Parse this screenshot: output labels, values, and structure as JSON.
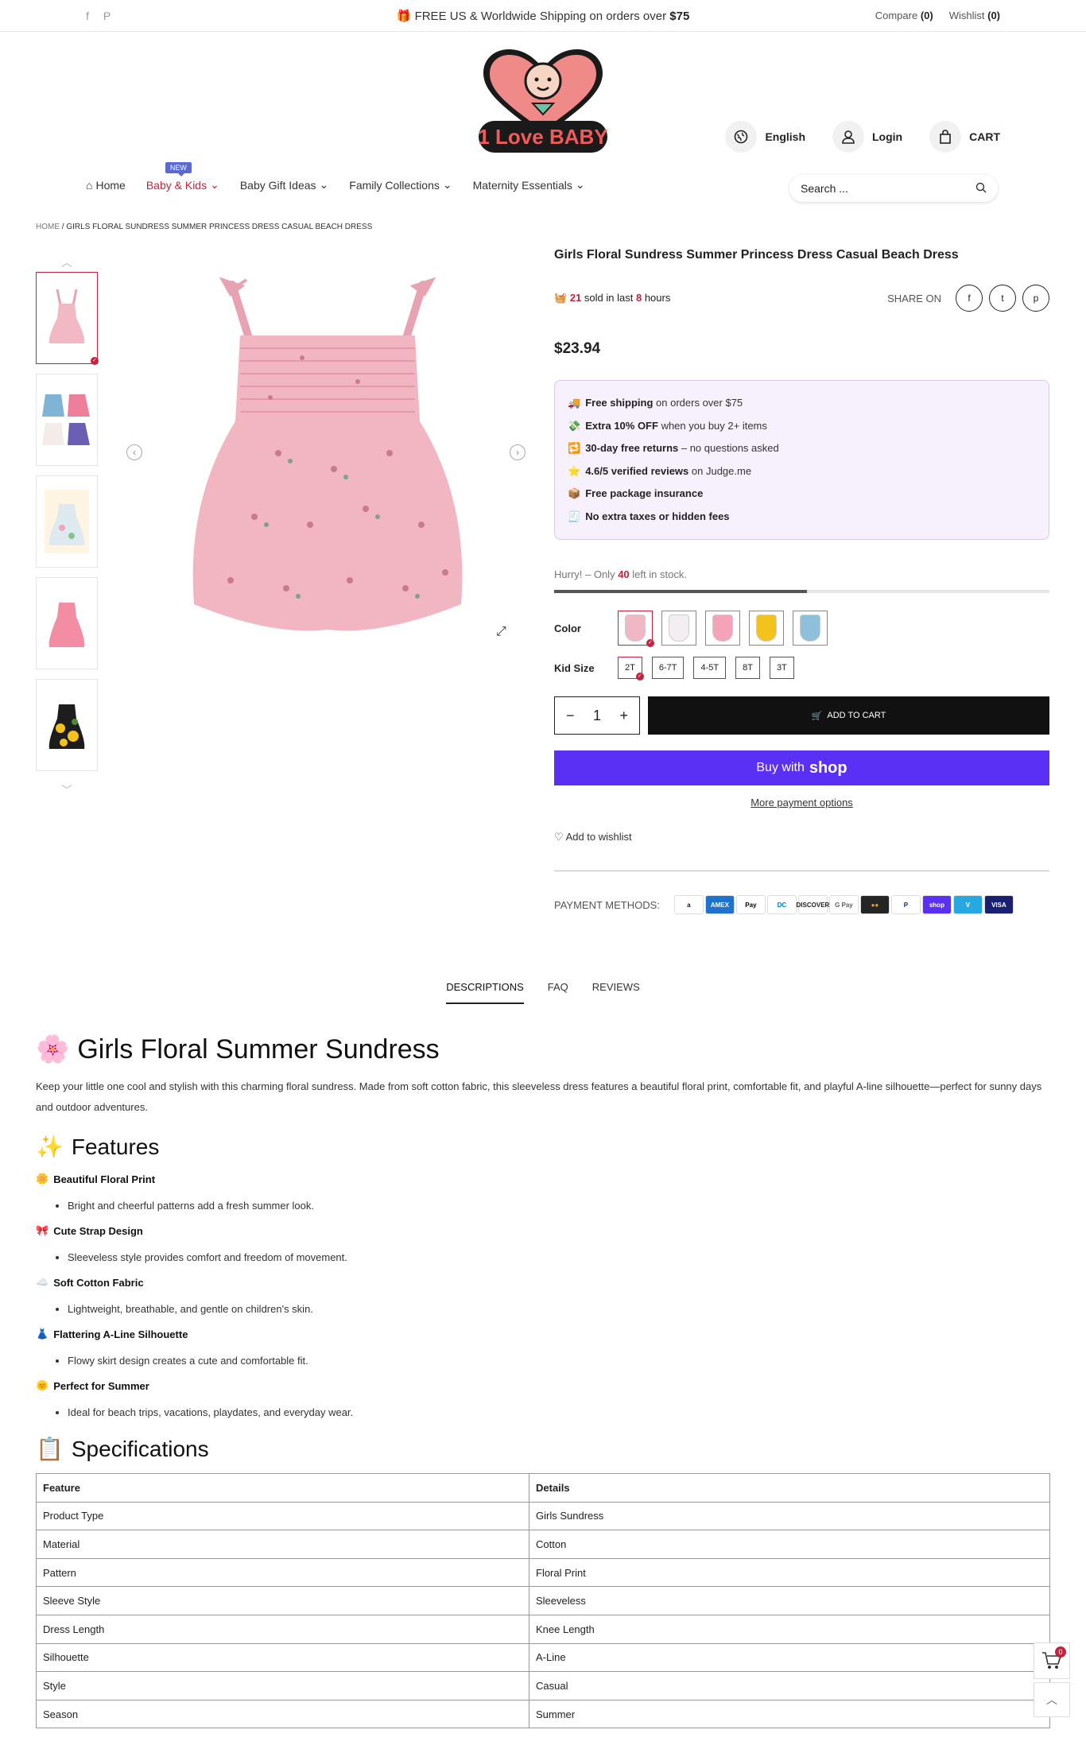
{
  "topbar": {
    "social": [
      "f",
      "P"
    ],
    "promo_prefix": "FREE US & Worldwide Shipping on orders over",
    "promo_amount": "$75",
    "compare_label": "Compare",
    "compare_count": "(0)",
    "wishlist_label": "Wishlist",
    "wishlist_count": "(0)"
  },
  "brand": {
    "logo_text": "1 Love BABY"
  },
  "header": {
    "language": "English",
    "login": "Login",
    "cart": "CART"
  },
  "nav": {
    "home": "Home",
    "new_badge": "NEW",
    "items": [
      "Baby & Kids",
      "Baby Gift Ideas",
      "Family Collections",
      "Maternity Essentials"
    ]
  },
  "search": {
    "placeholder": "Search ..."
  },
  "breadcrumb": {
    "home": "HOME",
    "sep": "/",
    "current": "GIRLS FLORAL SUNDRESS SUMMER PRINCESS DRESS CASUAL BEACH DRESS"
  },
  "product": {
    "title": "Girls Floral Sundress Summer Princess Dress Casual Beach Dress",
    "sold_count": "21",
    "sold_text_1": "sold in last",
    "sold_hours": "8",
    "sold_text_2": "hours",
    "share_label": "SHARE ON",
    "share_icons": [
      "f",
      "t",
      "p"
    ],
    "price": "$23.94",
    "perks": [
      {
        "icon": "🚚",
        "bold": "Free shipping",
        "rest": " on orders over $75"
      },
      {
        "icon": "💸",
        "bold": "Extra 10% OFF",
        "rest": " when you buy 2+ items"
      },
      {
        "icon": "🔁",
        "bold": "30-day free returns",
        "rest": " – no questions asked"
      },
      {
        "icon": "⭐",
        "bold": "4.6/5 verified reviews",
        "rest": " on Judge.me"
      },
      {
        "icon": "📦",
        "bold": "Free package insurance",
        "rest": ""
      },
      {
        "icon": "🧾",
        "bold": "No extra taxes or hidden fees",
        "rest": ""
      }
    ],
    "stock_prefix": "Hurry! – Only",
    "stock_count": "40",
    "stock_suffix": "left in stock.",
    "stock_fraction": 0.51,
    "color_label": "Color",
    "colors": [
      "#f0b7c4",
      "#f3eef2",
      "#f4a3b8",
      "#f2c31c",
      "#8ebfdb"
    ],
    "size_label": "Kid Size",
    "sizes": [
      "2T",
      "6-7T",
      "4-5T",
      "8T",
      "3T"
    ],
    "qty_minus": "−",
    "qty_value": "1",
    "qty_plus": "+",
    "add_to_cart": "ADD TO CART",
    "buy_with": "Buy with",
    "shop_word": "shop",
    "more_payment": "More payment options",
    "wishlist": "Add to wishlist",
    "payment_label": "PAYMENT METHODS:",
    "payment_cards": [
      {
        "label": "a",
        "bg": "#ffffff",
        "fg": "#111111"
      },
      {
        "label": "AMEX",
        "bg": "#1f72cd",
        "fg": "#ffffff"
      },
      {
        "label": " Pay",
        "bg": "#ffffff",
        "fg": "#000000"
      },
      {
        "label": "DC",
        "bg": "#ffffff",
        "fg": "#0079be"
      },
      {
        "label": "DISCOVER",
        "bg": "#ffffff",
        "fg": "#222222"
      },
      {
        "label": "G Pay",
        "bg": "#ffffff",
        "fg": "#5f6368"
      },
      {
        "label": "●●",
        "bg": "#252525",
        "fg": "#f79e1b"
      },
      {
        "label": "P",
        "bg": "#ffffff",
        "fg": "#003087"
      },
      {
        "label": "shop",
        "bg": "#5a31f4",
        "fg": "#ffffff"
      },
      {
        "label": "V",
        "bg": "#28a8e0",
        "fg": "#ffffff"
      },
      {
        "label": "VISA",
        "bg": "#1a1f71",
        "fg": "#ffffff"
      }
    ]
  },
  "tabs": [
    "DESCRIPTIONS",
    "FAQ",
    "REVIEWS"
  ],
  "description": {
    "title_icon": "🌸",
    "title": "Girls Floral Summer Sundress",
    "lead": "Keep your little one cool and stylish with this charming floral sundress. Made from soft cotton fabric, this sleeveless dress features a beautiful floral print, comfortable fit, and playful A-line silhouette—perfect for sunny days and outdoor adventures.",
    "features_icon": "✨",
    "features_title": "Features",
    "features": [
      {
        "icon": "🌼",
        "title": "Beautiful Floral Print",
        "text": "Bright and cheerful patterns add a fresh summer look."
      },
      {
        "icon": "🎀",
        "title": "Cute Strap Design",
        "text": "Sleeveless style provides comfort and freedom of movement."
      },
      {
        "icon": "☁️",
        "title": "Soft Cotton Fabric",
        "text": "Lightweight, breathable, and gentle on children's skin."
      },
      {
        "icon": "👗",
        "title": "Flattering A-Line Silhouette",
        "text": "Flowy skirt design creates a cute and comfortable fit."
      },
      {
        "icon": "🌞",
        "title": "Perfect for Summer",
        "text": "Ideal for beach trips, vacations, playdates, and everyday wear."
      }
    ],
    "spec_icon": "📋",
    "spec_title": "Specifications",
    "spec_headers": [
      "Feature",
      "Details"
    ],
    "spec_rows": [
      [
        "Product Type",
        "Girls Sundress"
      ],
      [
        "Material",
        "Cotton"
      ],
      [
        "Pattern",
        "Floral Print"
      ],
      [
        "Sleeve Style",
        "Sleeveless"
      ],
      [
        "Dress Length",
        "Knee Length"
      ],
      [
        "Silhouette",
        "A-Line"
      ],
      [
        "Style",
        "Casual"
      ],
      [
        "Season",
        "Summer"
      ]
    ]
  },
  "floating": {
    "cart_count": "0"
  }
}
